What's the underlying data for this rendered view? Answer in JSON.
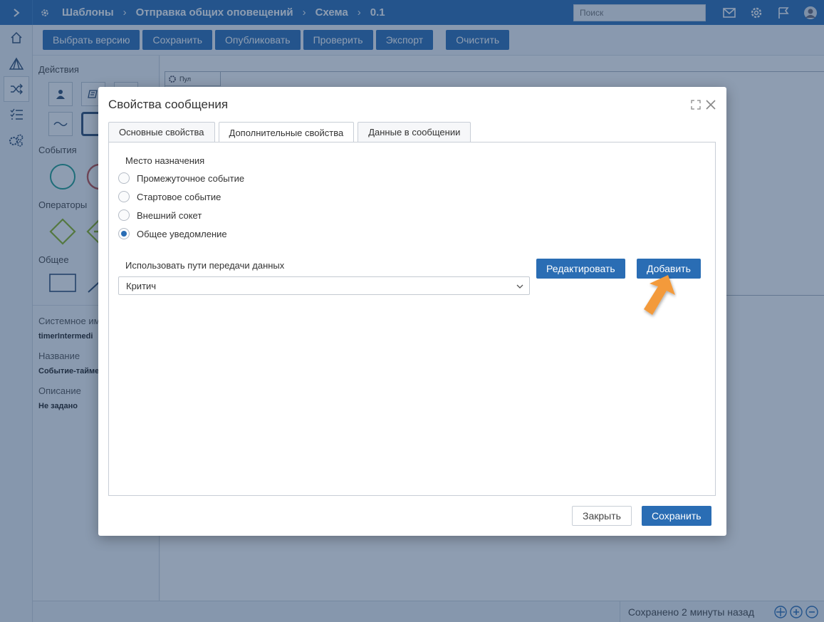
{
  "topbar": {
    "crumbs": [
      "Шаблоны",
      "Отправка общих оповещений",
      "Схема",
      "0.1"
    ],
    "search_placeholder": "Поиск"
  },
  "toolbar": {
    "buttons": [
      "Выбрать версию",
      "Сохранить",
      "Опубликовать",
      "Проверить",
      "Экспорт",
      "Очистить"
    ]
  },
  "palette": {
    "actions_title": "Действия",
    "events_title": "События",
    "operators_title": "Операторы",
    "general_title": "Общее",
    "system_name_label": "Системное им",
    "system_name_value": "timerIntermedi",
    "name_label": "Название",
    "name_value": "Событие-тайме",
    "description_label": "Описание",
    "description_value": "Не задано"
  },
  "canvas": {
    "pool_label": "Пул"
  },
  "statusbar": {
    "saved_text": "Сохранено 2 минуты назад"
  },
  "modal": {
    "title": "Свойства сообщения",
    "tabs": [
      "Основные свойства",
      "Дополнительные свойства",
      "Данные в сообщении"
    ],
    "active_tab": "Дополнительные свойства",
    "destination_title": "Место назначения",
    "destination_options": [
      "Промежуточное событие",
      "Стартовое событие",
      "Внешний сокет",
      "Общее уведомление"
    ],
    "destination_selected": "Общее уведомление",
    "paths_label": "Использовать пути передачи данных",
    "paths_value": "Критич",
    "edit_button": "Редактировать",
    "add_button": "Добавить",
    "close_button": "Закрыть",
    "save_button": "Сохранить"
  },
  "colors": {
    "primary": "#2a6db4",
    "cursor": "#f39a3a",
    "overlay": "rgba(30,60,100,0.5)"
  }
}
